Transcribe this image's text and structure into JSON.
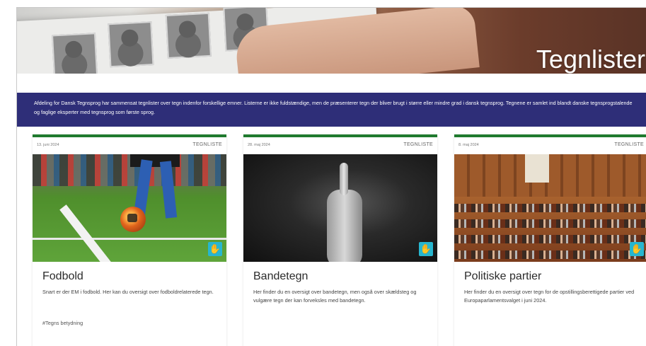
{
  "hero": {
    "title": "Tegnlister"
  },
  "intro": {
    "text": "Afdeling for Dansk Tegnsprog har sammensat tegnlister over tegn indenfor forskellige emner. Listerne er ikke fuldstændige, men de præsenterer tegn der bliver brugt i større eller mindre grad i dansk tegnsprog. Tegnene er samlet ind blandt danske tegnsprogstalende og faglige eksperter med tegnsprog som første sprog."
  },
  "cards": [
    {
      "date": "13. juni 2024",
      "tag": "TEGNLISTE",
      "title": "Fodbold",
      "description": "Snart er der EM i fodbold. Her kan du oversigt over fodboldrelaterede tegn.",
      "hashtag": "#Tegns betydning",
      "image_icon": "signing-person-icon"
    },
    {
      "date": "28. maj 2024",
      "tag": "TEGNLISTE",
      "title": "Bandetegn",
      "description": "Her finder du en oversigt over bandetegn, men også over skældsteg og vulgære tegn der kan forveksles med bandetegn.",
      "image_icon": "signing-person-icon"
    },
    {
      "date": "8. maj 2024",
      "tag": "TEGNLISTE",
      "title": "Politiske partier",
      "description": "Her finder du en oversigt over tegn for de opstillingsberettigede partier ved Europaparlamentsvalget i juni 2024.",
      "image_icon": "signing-person-icon"
    }
  ],
  "colors": {
    "band": "#2e2e78",
    "card_accent": "#1f7a2e",
    "sign_badge": "#27b6cf"
  }
}
